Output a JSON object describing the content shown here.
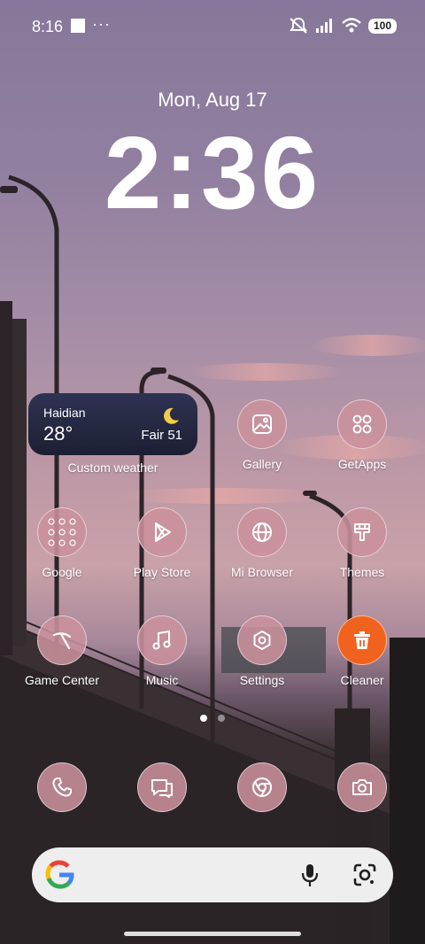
{
  "status_bar": {
    "time": "8:16",
    "more": "···",
    "battery": "100"
  },
  "lock": {
    "date": "Mon, Aug 17",
    "clock": "2:36"
  },
  "weather": {
    "city": "Haidian",
    "temp": "28°",
    "condition": "Fair 51",
    "label": "Custom weather"
  },
  "apps": {
    "gallery": "Gallery",
    "getapps": "GetApps",
    "google": "Google",
    "playstore": "Play Store",
    "browser": "Mi Browser",
    "themes": "Themes",
    "gamecenter": "Game Center",
    "music": "Music",
    "settings": "Settings",
    "cleaner": "Cleaner"
  },
  "dock": [
    "phone-icon",
    "messages-icon",
    "chrome-icon",
    "camera-icon"
  ],
  "page_indicator": {
    "count": 2,
    "active": 1
  },
  "colors": {
    "icon_bg": "#ca919c",
    "cleaner": "#f1621f",
    "widget": "#1c1f33"
  }
}
